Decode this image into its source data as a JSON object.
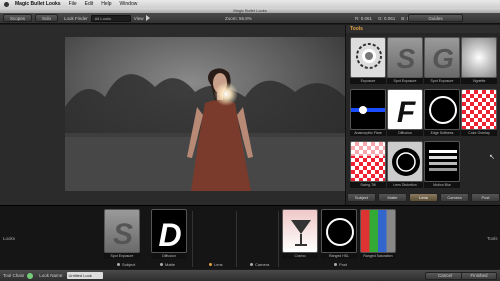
{
  "menubar": {
    "app_name": "Magic Bullet Looks",
    "menus": [
      "File",
      "Edit",
      "Help",
      "Window"
    ],
    "window_title": "Magic Bullet Looks"
  },
  "toolbar": {
    "scopes_label": "Scopes",
    "solo_label": "Solo",
    "look_finder_label": "Look Finder",
    "look_finder_value": "All Looks",
    "view_label": "View",
    "zoom_label": "Zoom:",
    "zoom_value": "56.8%",
    "readout": [
      "R: 0.061",
      "G: 0.061",
      "B: 0.078"
    ],
    "guides_label": "Guides"
  },
  "tools_panel": {
    "header": "Tools",
    "tools": [
      {
        "name": "Exposure",
        "icon": "exposure-icon"
      },
      {
        "name": "Spot Exposure",
        "icon": "spot-exposure-icon"
      },
      {
        "name": "Spot Exposure",
        "icon": "spot-exposure-icon"
      },
      {
        "name": "Vignette",
        "icon": "vignette-icon"
      },
      {
        "name": "Anamorphic Flare",
        "icon": "anamorphic-flare-icon"
      },
      {
        "name": "Diffusion",
        "icon": "diffusion-icon"
      },
      {
        "name": "Edge Softness",
        "icon": "edge-softness-icon"
      },
      {
        "name": "Color Overlay",
        "icon": "checker-icon"
      },
      {
        "name": "Swing-Tilt",
        "icon": "swing-tilt-icon"
      },
      {
        "name": "Lens Distortion",
        "icon": "lens-distortion-icon"
      },
      {
        "name": "Motion Blur",
        "icon": "motion-blur-icon"
      }
    ],
    "categories": [
      "Subject",
      "Matte",
      "Lens",
      "Camera",
      "Post"
    ],
    "active_category": "Lens"
  },
  "tool_chain": {
    "left_label": "Looks",
    "right_label": "Tools",
    "slots": [
      {
        "name": "Spot Exposure",
        "icon": "spot-exposure-icon"
      },
      {
        "name": "Diffusion",
        "icon": "diffusion-icon"
      },
      {
        "name": "Cosmo",
        "icon": "cosmo-icon"
      },
      {
        "name": "Ranged HSL",
        "icon": "ranged-hsl-icon"
      },
      {
        "name": "Ranged Saturation",
        "icon": "color-bars-icon"
      }
    ],
    "categories": [
      "Subject",
      "Matte",
      "Lens",
      "Camera",
      "Post"
    ]
  },
  "statusbar": {
    "tool_chain_label": "Tool Chain",
    "look_name_label": "Look Name:",
    "look_name_value": "Untitled Look",
    "cancel_label": "Cancel",
    "finished_label": "Finished"
  },
  "colors": {
    "accent": "#e0a040",
    "panel": "#262626",
    "chain_bg": "#151515"
  }
}
